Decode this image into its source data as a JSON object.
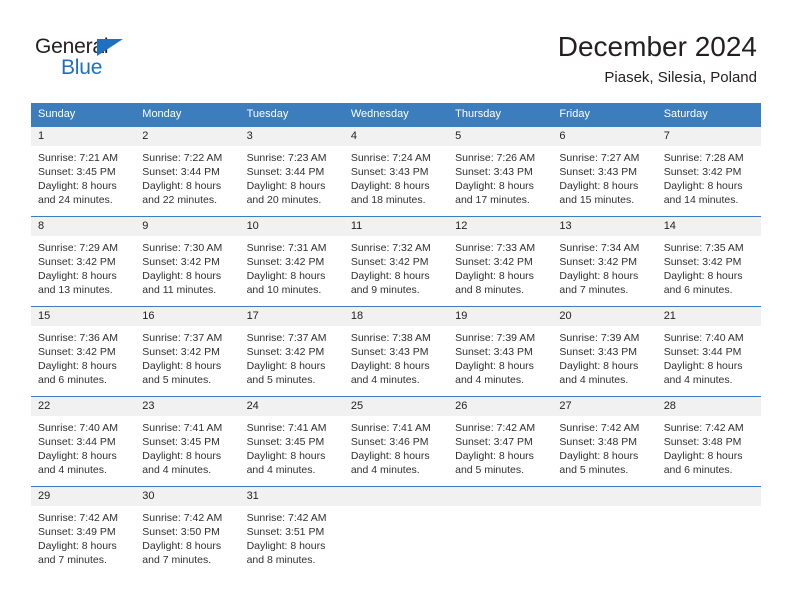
{
  "brand": {
    "line1": "General",
    "line2": "Blue",
    "triangle_color": "#1f70c1",
    "icon": "general-blue-logo"
  },
  "header": {
    "title": "December 2024",
    "subtitle": "Piasek, Silesia, Poland"
  },
  "theme": {
    "header_blue": "#3b7dbd",
    "row_divider_blue": "#3b7dbd",
    "daynum_band": "#f1f1f1",
    "text": "#231f20"
  },
  "weekdays": [
    "Sunday",
    "Monday",
    "Tuesday",
    "Wednesday",
    "Thursday",
    "Friday",
    "Saturday"
  ],
  "weeks": [
    [
      {
        "day": "1",
        "sunrise": "Sunrise: 7:21 AM",
        "sunset": "Sunset: 3:45 PM",
        "daylight1": "Daylight: 8 hours",
        "daylight2": "and 24 minutes."
      },
      {
        "day": "2",
        "sunrise": "Sunrise: 7:22 AM",
        "sunset": "Sunset: 3:44 PM",
        "daylight1": "Daylight: 8 hours",
        "daylight2": "and 22 minutes."
      },
      {
        "day": "3",
        "sunrise": "Sunrise: 7:23 AM",
        "sunset": "Sunset: 3:44 PM",
        "daylight1": "Daylight: 8 hours",
        "daylight2": "and 20 minutes."
      },
      {
        "day": "4",
        "sunrise": "Sunrise: 7:24 AM",
        "sunset": "Sunset: 3:43 PM",
        "daylight1": "Daylight: 8 hours",
        "daylight2": "and 18 minutes."
      },
      {
        "day": "5",
        "sunrise": "Sunrise: 7:26 AM",
        "sunset": "Sunset: 3:43 PM",
        "daylight1": "Daylight: 8 hours",
        "daylight2": "and 17 minutes."
      },
      {
        "day": "6",
        "sunrise": "Sunrise: 7:27 AM",
        "sunset": "Sunset: 3:43 PM",
        "daylight1": "Daylight: 8 hours",
        "daylight2": "and 15 minutes."
      },
      {
        "day": "7",
        "sunrise": "Sunrise: 7:28 AM",
        "sunset": "Sunset: 3:42 PM",
        "daylight1": "Daylight: 8 hours",
        "daylight2": "and 14 minutes."
      }
    ],
    [
      {
        "day": "8",
        "sunrise": "Sunrise: 7:29 AM",
        "sunset": "Sunset: 3:42 PM",
        "daylight1": "Daylight: 8 hours",
        "daylight2": "and 13 minutes."
      },
      {
        "day": "9",
        "sunrise": "Sunrise: 7:30 AM",
        "sunset": "Sunset: 3:42 PM",
        "daylight1": "Daylight: 8 hours",
        "daylight2": "and 11 minutes."
      },
      {
        "day": "10",
        "sunrise": "Sunrise: 7:31 AM",
        "sunset": "Sunset: 3:42 PM",
        "daylight1": "Daylight: 8 hours",
        "daylight2": "and 10 minutes."
      },
      {
        "day": "11",
        "sunrise": "Sunrise: 7:32 AM",
        "sunset": "Sunset: 3:42 PM",
        "daylight1": "Daylight: 8 hours",
        "daylight2": "and 9 minutes."
      },
      {
        "day": "12",
        "sunrise": "Sunrise: 7:33 AM",
        "sunset": "Sunset: 3:42 PM",
        "daylight1": "Daylight: 8 hours",
        "daylight2": "and 8 minutes."
      },
      {
        "day": "13",
        "sunrise": "Sunrise: 7:34 AM",
        "sunset": "Sunset: 3:42 PM",
        "daylight1": "Daylight: 8 hours",
        "daylight2": "and 7 minutes."
      },
      {
        "day": "14",
        "sunrise": "Sunrise: 7:35 AM",
        "sunset": "Sunset: 3:42 PM",
        "daylight1": "Daylight: 8 hours",
        "daylight2": "and 6 minutes."
      }
    ],
    [
      {
        "day": "15",
        "sunrise": "Sunrise: 7:36 AM",
        "sunset": "Sunset: 3:42 PM",
        "daylight1": "Daylight: 8 hours",
        "daylight2": "and 6 minutes."
      },
      {
        "day": "16",
        "sunrise": "Sunrise: 7:37 AM",
        "sunset": "Sunset: 3:42 PM",
        "daylight1": "Daylight: 8 hours",
        "daylight2": "and 5 minutes."
      },
      {
        "day": "17",
        "sunrise": "Sunrise: 7:37 AM",
        "sunset": "Sunset: 3:42 PM",
        "daylight1": "Daylight: 8 hours",
        "daylight2": "and 5 minutes."
      },
      {
        "day": "18",
        "sunrise": "Sunrise: 7:38 AM",
        "sunset": "Sunset: 3:43 PM",
        "daylight1": "Daylight: 8 hours",
        "daylight2": "and 4 minutes."
      },
      {
        "day": "19",
        "sunrise": "Sunrise: 7:39 AM",
        "sunset": "Sunset: 3:43 PM",
        "daylight1": "Daylight: 8 hours",
        "daylight2": "and 4 minutes."
      },
      {
        "day": "20",
        "sunrise": "Sunrise: 7:39 AM",
        "sunset": "Sunset: 3:43 PM",
        "daylight1": "Daylight: 8 hours",
        "daylight2": "and 4 minutes."
      },
      {
        "day": "21",
        "sunrise": "Sunrise: 7:40 AM",
        "sunset": "Sunset: 3:44 PM",
        "daylight1": "Daylight: 8 hours",
        "daylight2": "and 4 minutes."
      }
    ],
    [
      {
        "day": "22",
        "sunrise": "Sunrise: 7:40 AM",
        "sunset": "Sunset: 3:44 PM",
        "daylight1": "Daylight: 8 hours",
        "daylight2": "and 4 minutes."
      },
      {
        "day": "23",
        "sunrise": "Sunrise: 7:41 AM",
        "sunset": "Sunset: 3:45 PM",
        "daylight1": "Daylight: 8 hours",
        "daylight2": "and 4 minutes."
      },
      {
        "day": "24",
        "sunrise": "Sunrise: 7:41 AM",
        "sunset": "Sunset: 3:45 PM",
        "daylight1": "Daylight: 8 hours",
        "daylight2": "and 4 minutes."
      },
      {
        "day": "25",
        "sunrise": "Sunrise: 7:41 AM",
        "sunset": "Sunset: 3:46 PM",
        "daylight1": "Daylight: 8 hours",
        "daylight2": "and 4 minutes."
      },
      {
        "day": "26",
        "sunrise": "Sunrise: 7:42 AM",
        "sunset": "Sunset: 3:47 PM",
        "daylight1": "Daylight: 8 hours",
        "daylight2": "and 5 minutes."
      },
      {
        "day": "27",
        "sunrise": "Sunrise: 7:42 AM",
        "sunset": "Sunset: 3:48 PM",
        "daylight1": "Daylight: 8 hours",
        "daylight2": "and 5 minutes."
      },
      {
        "day": "28",
        "sunrise": "Sunrise: 7:42 AM",
        "sunset": "Sunset: 3:48 PM",
        "daylight1": "Daylight: 8 hours",
        "daylight2": "and 6 minutes."
      }
    ],
    [
      {
        "day": "29",
        "sunrise": "Sunrise: 7:42 AM",
        "sunset": "Sunset: 3:49 PM",
        "daylight1": "Daylight: 8 hours",
        "daylight2": "and 7 minutes."
      },
      {
        "day": "30",
        "sunrise": "Sunrise: 7:42 AM",
        "sunset": "Sunset: 3:50 PM",
        "daylight1": "Daylight: 8 hours",
        "daylight2": "and 7 minutes."
      },
      {
        "day": "31",
        "sunrise": "Sunrise: 7:42 AM",
        "sunset": "Sunset: 3:51 PM",
        "daylight1": "Daylight: 8 hours",
        "daylight2": "and 8 minutes."
      },
      {
        "day": "",
        "sunrise": "",
        "sunset": "",
        "daylight1": "",
        "daylight2": ""
      },
      {
        "day": "",
        "sunrise": "",
        "sunset": "",
        "daylight1": "",
        "daylight2": ""
      },
      {
        "day": "",
        "sunrise": "",
        "sunset": "",
        "daylight1": "",
        "daylight2": ""
      },
      {
        "day": "",
        "sunrise": "",
        "sunset": "",
        "daylight1": "",
        "daylight2": ""
      }
    ]
  ]
}
